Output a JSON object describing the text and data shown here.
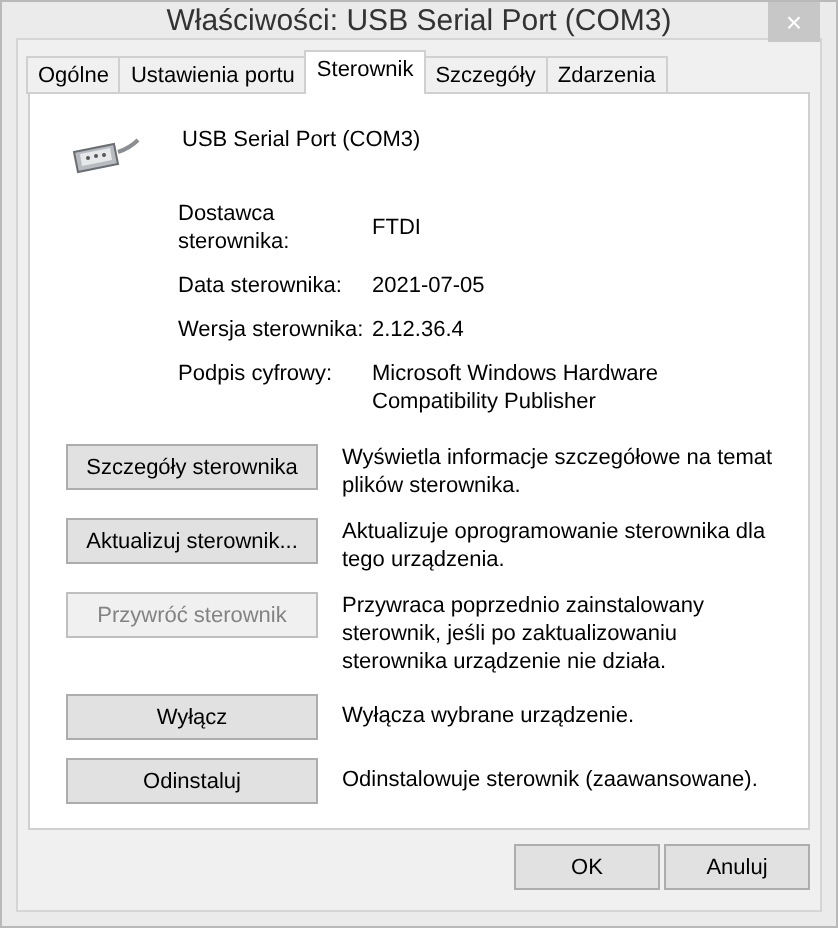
{
  "window": {
    "title": "Właściwości: USB Serial Port (COM3)",
    "close": "×"
  },
  "tabs": [
    {
      "label": "Ogólne",
      "selected": false
    },
    {
      "label": "Ustawienia portu",
      "selected": false
    },
    {
      "label": "Sterownik",
      "selected": true
    },
    {
      "label": "Szczegóły",
      "selected": false
    },
    {
      "label": "Zdarzenia",
      "selected": false
    }
  ],
  "device": {
    "name": "USB Serial Port (COM3)"
  },
  "properties": [
    {
      "label": "Dostawca sterownika:",
      "value": "FTDI"
    },
    {
      "label": "Data sterownika:",
      "value": "2021-07-05"
    },
    {
      "label": "Wersja sterownika:",
      "value": "2.12.36.4"
    },
    {
      "label": "Podpis cyfrowy:",
      "value": "Microsoft Windows Hardware Compatibility Publisher"
    }
  ],
  "actions": [
    {
      "button": "Szczegóły sterownika",
      "description": "Wyświetla informacje szczegółowe na temat plików sterownika.",
      "disabled": false
    },
    {
      "button": "Aktualizuj sterownik...",
      "description": "Aktualizuje oprogramowanie sterownika dla tego urządzenia.",
      "disabled": false
    },
    {
      "button": "Przywróć sterownik",
      "description": "Przywraca poprzednio zainstalowany sterownik, jeśli po zaktualizowaniu sterownika urządzenie nie działa.",
      "disabled": true
    },
    {
      "button": "Wyłącz",
      "description": "Wyłącza wybrane urządzenie.",
      "disabled": false
    },
    {
      "button": "Odinstaluj",
      "description": "Odinstalowuje sterownik (zaawansowane).",
      "disabled": false
    }
  ],
  "buttons": [
    "OK",
    "Anuluj"
  ]
}
